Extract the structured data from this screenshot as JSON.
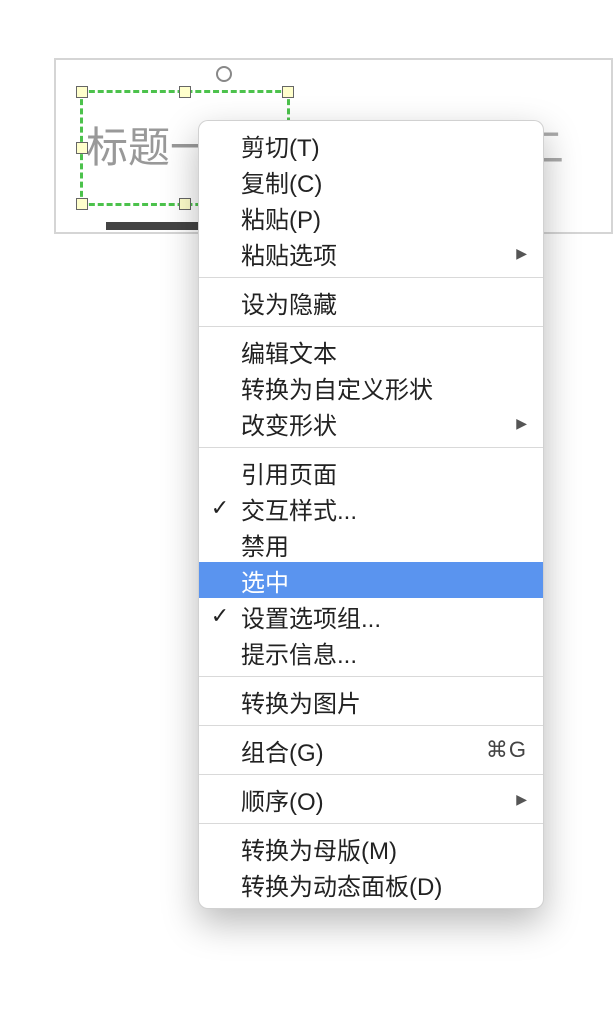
{
  "canvas": {
    "tab1_label": "标题一",
    "tab2_label": "标题二"
  },
  "menu": {
    "rows": [
      {
        "kind": "item",
        "label": "剪切(T)",
        "checked": false,
        "submenu": false,
        "shortcut": ""
      },
      {
        "kind": "item",
        "label": "复制(C)",
        "checked": false,
        "submenu": false,
        "shortcut": ""
      },
      {
        "kind": "item",
        "label": "粘贴(P)",
        "checked": false,
        "submenu": false,
        "shortcut": ""
      },
      {
        "kind": "item",
        "label": "粘贴选项",
        "checked": false,
        "submenu": true,
        "shortcut": ""
      },
      {
        "kind": "sep"
      },
      {
        "kind": "item",
        "label": "设为隐藏",
        "checked": false,
        "submenu": false,
        "shortcut": ""
      },
      {
        "kind": "sep"
      },
      {
        "kind": "item",
        "label": "编辑文本",
        "checked": false,
        "submenu": false,
        "shortcut": ""
      },
      {
        "kind": "item",
        "label": "转换为自定义形状",
        "checked": false,
        "submenu": false,
        "shortcut": ""
      },
      {
        "kind": "item",
        "label": "改变形状",
        "checked": false,
        "submenu": true,
        "shortcut": ""
      },
      {
        "kind": "sep"
      },
      {
        "kind": "item",
        "label": "引用页面",
        "checked": false,
        "submenu": false,
        "shortcut": ""
      },
      {
        "kind": "item",
        "label": "交互样式...",
        "checked": true,
        "submenu": false,
        "shortcut": ""
      },
      {
        "kind": "item",
        "label": "禁用",
        "checked": false,
        "submenu": false,
        "shortcut": ""
      },
      {
        "kind": "item",
        "label": "选中",
        "checked": false,
        "submenu": false,
        "shortcut": "",
        "highlighted": true
      },
      {
        "kind": "item",
        "label": "设置选项组...",
        "checked": true,
        "submenu": false,
        "shortcut": ""
      },
      {
        "kind": "item",
        "label": "提示信息...",
        "checked": false,
        "submenu": false,
        "shortcut": ""
      },
      {
        "kind": "sep"
      },
      {
        "kind": "item",
        "label": "转换为图片",
        "checked": false,
        "submenu": false,
        "shortcut": ""
      },
      {
        "kind": "sep"
      },
      {
        "kind": "item",
        "label": "组合(G)",
        "checked": false,
        "submenu": false,
        "shortcut": "⌘G"
      },
      {
        "kind": "sep"
      },
      {
        "kind": "item",
        "label": "顺序(O)",
        "checked": false,
        "submenu": true,
        "shortcut": ""
      },
      {
        "kind": "sep"
      },
      {
        "kind": "item",
        "label": "转换为母版(M)",
        "checked": false,
        "submenu": false,
        "shortcut": ""
      },
      {
        "kind": "item",
        "label": "转换为动态面板(D)",
        "checked": false,
        "submenu": false,
        "shortcut": ""
      }
    ]
  }
}
